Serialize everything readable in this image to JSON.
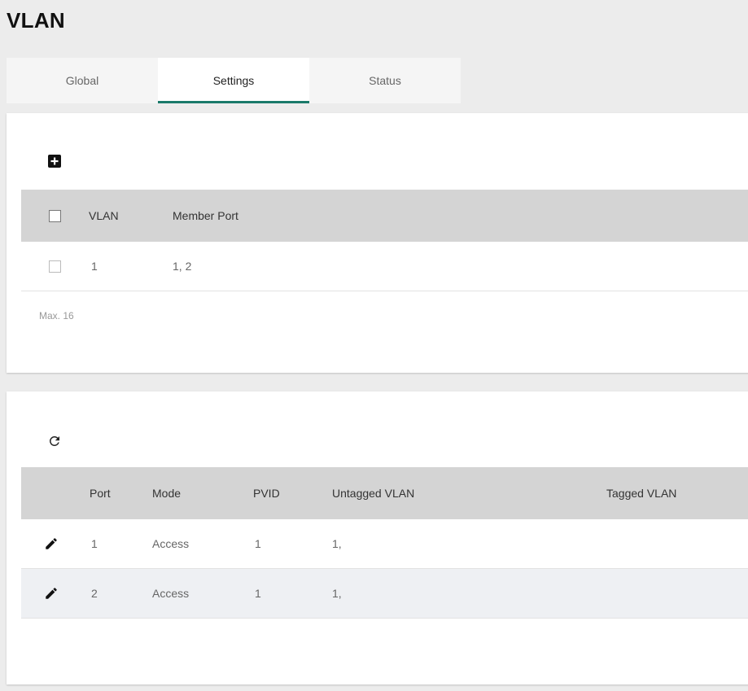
{
  "page": {
    "title": "VLAN"
  },
  "tabs": [
    {
      "label": "Global",
      "active": false
    },
    {
      "label": "Settings",
      "active": true
    },
    {
      "label": "Status",
      "active": false
    }
  ],
  "vlan_table": {
    "add_icon": "add-box-icon",
    "columns": [
      "VLAN",
      "Member Port"
    ],
    "rows": [
      {
        "vlan": "1",
        "member_port": "1, 2"
      }
    ],
    "footer": "Max. 16"
  },
  "port_table": {
    "refresh_icon": "refresh-icon",
    "columns": [
      "Port",
      "Mode",
      "PVID",
      "Untagged VLAN",
      "Tagged VLAN"
    ],
    "rows": [
      {
        "edit_icon": "pencil-icon",
        "port": "1",
        "mode": "Access",
        "pvid": "1",
        "untagged_vlan": "1,",
        "tagged_vlan": ""
      },
      {
        "edit_icon": "pencil-icon",
        "port": "2",
        "mode": "Access",
        "pvid": "1",
        "untagged_vlan": "1,",
        "tagged_vlan": ""
      }
    ]
  },
  "colors": {
    "accent": "#1a7a6a",
    "header_bg": "#d4d4d4",
    "alt_row_bg": "#eef0f3"
  }
}
